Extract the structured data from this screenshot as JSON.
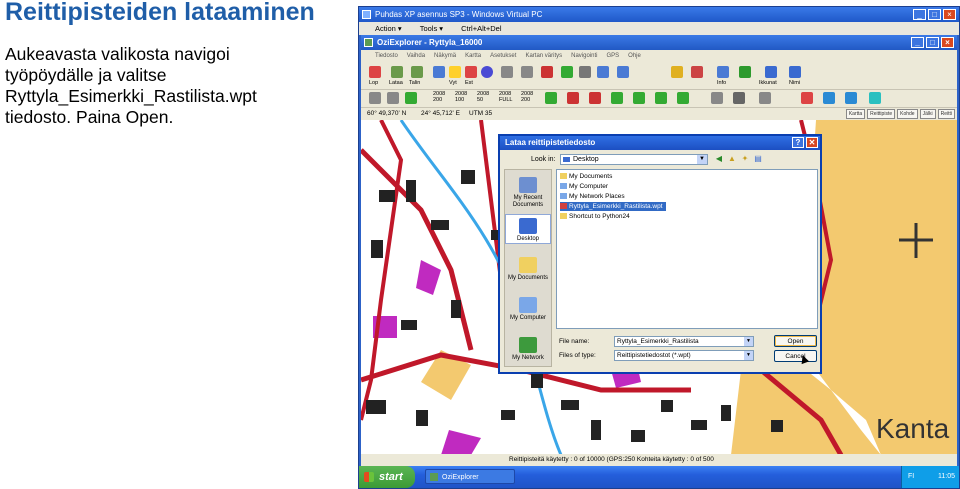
{
  "slide": {
    "title": "Reittipisteiden lataaminen",
    "body_lines": [
      "Aukeavasta valikosta navigoi",
      "työpöydälle ja valitse",
      "Ryttyla_Esimerkki_Rastilista.wpt",
      "tiedosto. Paina Open."
    ]
  },
  "vm_window": {
    "title": "Puhdas XP asennus SP3 - Windows Virtual PC",
    "menu": [
      "Action ▾",
      "Tools ▾",
      "Ctrl+Alt+Del"
    ]
  },
  "ozi": {
    "title": "OziExplorer - Ryttyla_16000",
    "menu": [
      "Tiedosto",
      "Vaihda",
      "Näkymä",
      "Kartta",
      "Asetukset",
      "Kartan väritys",
      "Navigointi",
      "GPS",
      "Ohje"
    ],
    "toolbar_labels": [
      "Lop",
      "Lataa",
      "Talin",
      "Vyt",
      "Est",
      "Info",
      "Ikkunat",
      "Nimi"
    ],
    "toolbar2_labels": [
      "2008",
      "2008",
      "2008",
      "2008",
      "2008"
    ],
    "toolbar2_sub": [
      "200",
      "100",
      "50",
      "FULL",
      "200"
    ],
    "scale_value": "500",
    "coords": {
      "lat": "60° 49,370' N",
      "lon": "24° 45,712' E",
      "utm": "UTM 35"
    },
    "right_buttons": [
      "Kartta",
      "Reittipiste",
      "Kohde",
      "Jälki",
      "Reitti"
    ]
  },
  "dialog": {
    "title": "Lataa reittipistetiedosto",
    "look_in_label": "Look in:",
    "look_in_value": "Desktop",
    "places": [
      "My Recent Documents",
      "Desktop",
      "My Documents",
      "My Computer",
      "My Network"
    ],
    "files": [
      {
        "name": "My Documents",
        "selected": false,
        "color": "#f0d060"
      },
      {
        "name": "My Computer",
        "selected": false,
        "color": "#7aa7e8"
      },
      {
        "name": "My Network Places",
        "selected": false,
        "color": "#7aa7e8"
      },
      {
        "name": "Ryttyla_Esimerkki_Rastilista.wpt",
        "selected": true,
        "color": "#d04040"
      },
      {
        "name": "Shortcut to Python24",
        "selected": false,
        "color": "#f0d060"
      }
    ],
    "file_name_label": "File name:",
    "file_name_value": "Ryttyla_Esimerkki_Rastilista",
    "file_type_label": "Files of type:",
    "file_type_value": "Reittipistetiedostot (*.wpt)",
    "open_label": "Open",
    "cancel_label": "Cancel",
    "help_label": "?",
    "close_label": "✕"
  },
  "status": {
    "text": "Reittipisteitä käytetty : 0 of 10000 (GPS:250 Kohteita käytetty : 0 of 500"
  },
  "taskbar": {
    "start": "start",
    "item": "OziExplorer",
    "tray": "FI",
    "time": "11:05"
  },
  "map_label": "Kanta",
  "colors": {
    "accent": "#1f5ea8",
    "map_orange": "#f3c96f",
    "map_road": "#c0182a",
    "map_building": "#222222",
    "map_magenta": "#c02ac0",
    "map_water": "#3aa6e8"
  }
}
